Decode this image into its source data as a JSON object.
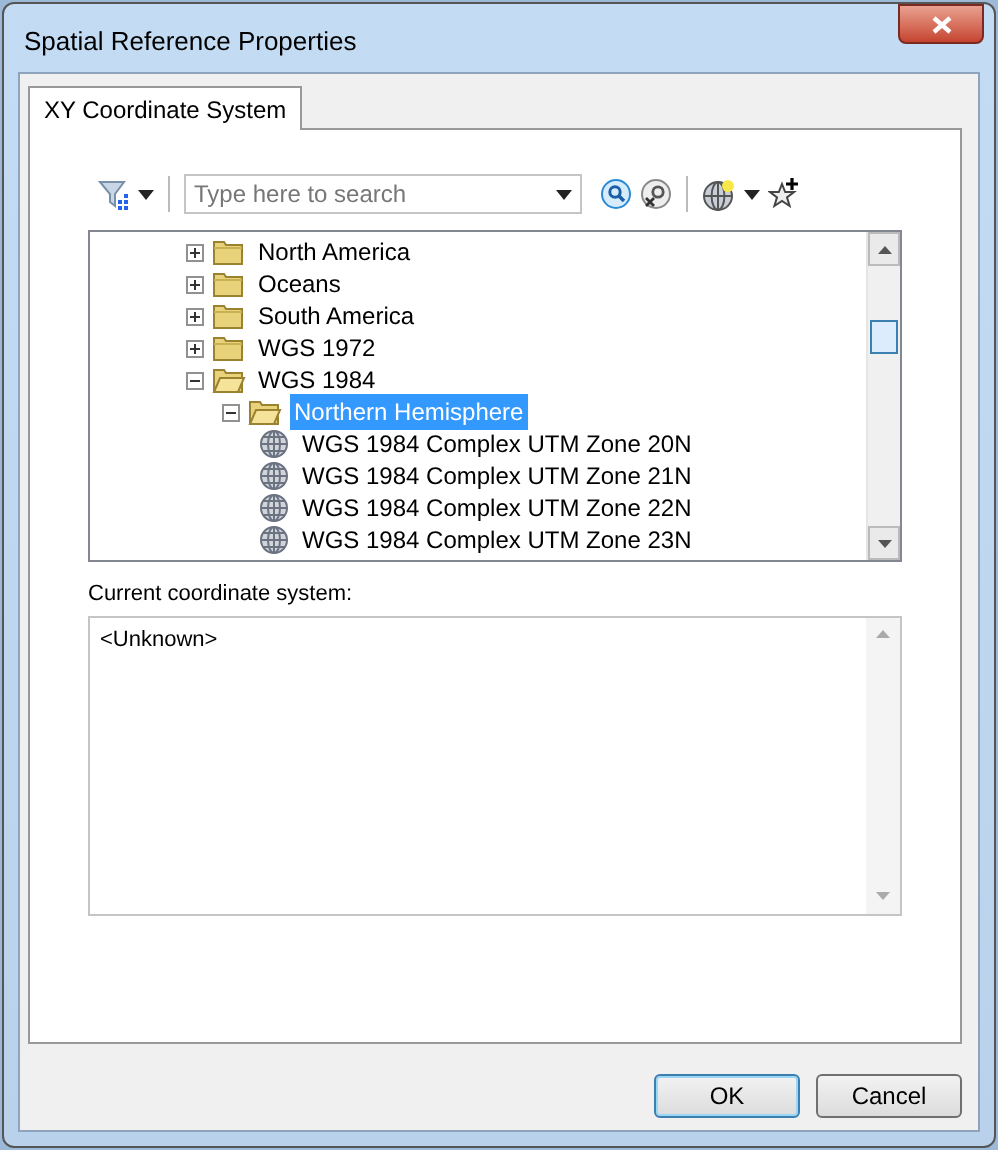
{
  "window": {
    "title": "Spatial Reference Properties"
  },
  "tabs": [
    {
      "label": "XY Coordinate System",
      "selected": true
    }
  ],
  "search": {
    "placeholder": "Type here to search"
  },
  "tree": [
    {
      "label": "North America",
      "kind": "folder",
      "expanded": false,
      "selected": false
    },
    {
      "label": "Oceans",
      "kind": "folder",
      "expanded": false,
      "selected": false
    },
    {
      "label": "South America",
      "kind": "folder",
      "expanded": false,
      "selected": false
    },
    {
      "label": "WGS 1972",
      "kind": "folder",
      "expanded": false,
      "selected": false
    },
    {
      "label": "WGS 1984",
      "kind": "folder",
      "expanded": true,
      "selected": false,
      "children": [
        {
          "label": "Northern Hemisphere",
          "kind": "folder",
          "expanded": true,
          "selected": true,
          "children": [
            {
              "label": "WGS 1984 Complex UTM Zone 20N",
              "kind": "system",
              "selected": false
            },
            {
              "label": "WGS 1984 Complex UTM Zone 21N",
              "kind": "system",
              "selected": false
            },
            {
              "label": "WGS 1984 Complex UTM Zone 22N",
              "kind": "system",
              "selected": false
            },
            {
              "label": "WGS 1984 Complex UTM Zone 23N",
              "kind": "system",
              "selected": false
            }
          ]
        }
      ]
    }
  ],
  "current": {
    "label": "Current coordinate system:",
    "value": "<Unknown>"
  },
  "buttons": [
    {
      "label": "OK",
      "default": true
    },
    {
      "label": "Cancel",
      "default": false
    }
  ]
}
